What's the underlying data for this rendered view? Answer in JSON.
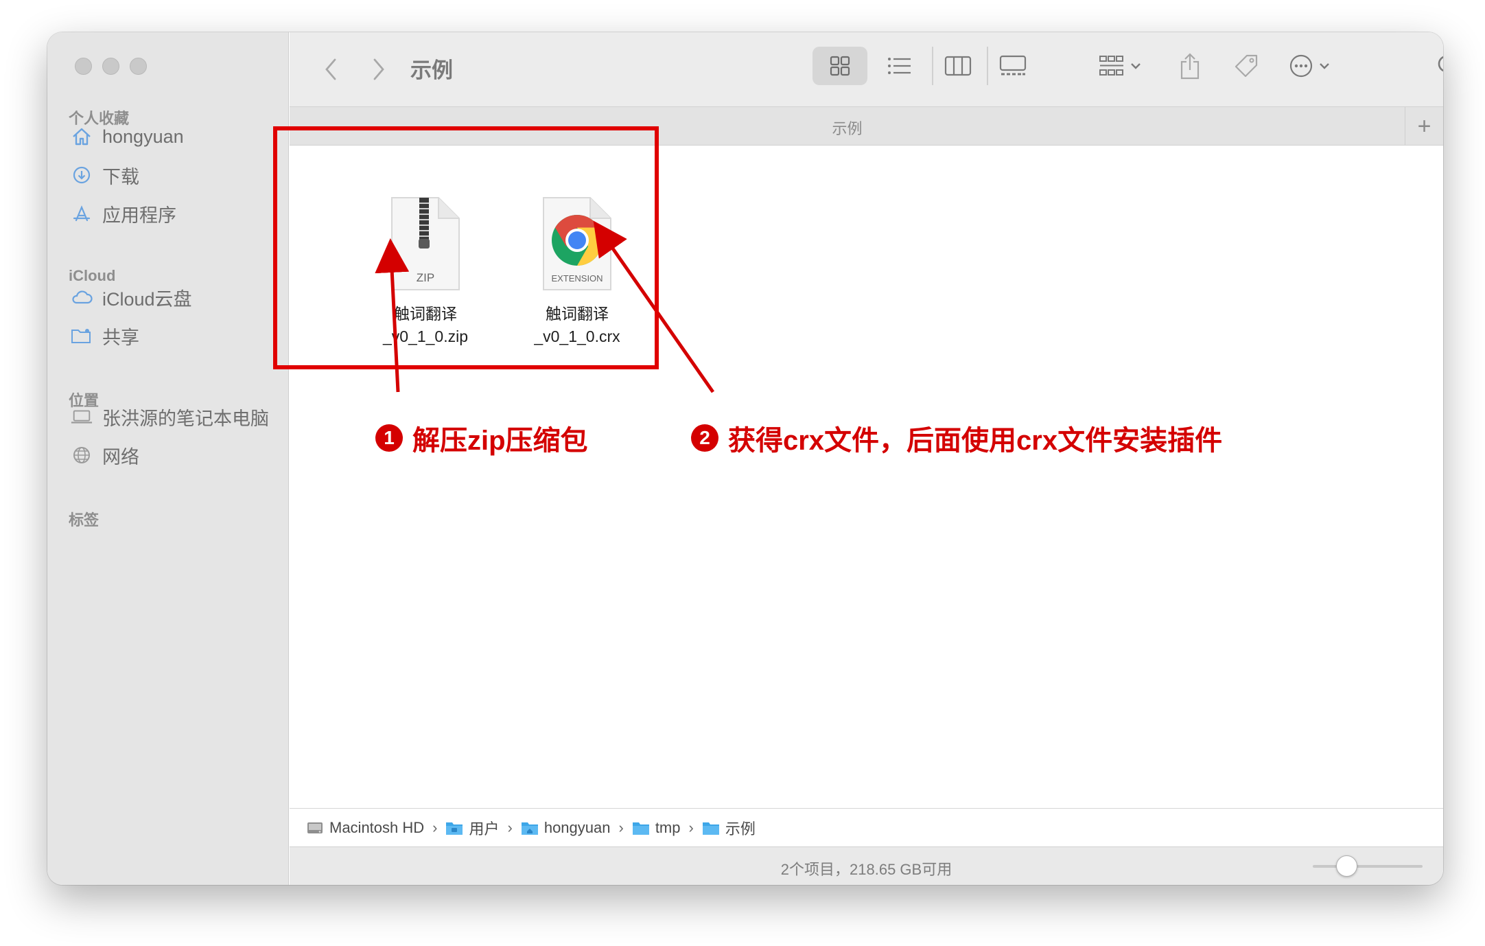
{
  "window": {
    "title": "示例"
  },
  "sidebar": {
    "favorites_header": "个人收藏",
    "favorites": [
      {
        "label": "hongyuan",
        "icon": "house-icon"
      },
      {
        "label": "下载",
        "icon": "download-icon"
      },
      {
        "label": "应用程序",
        "icon": "applications-icon"
      }
    ],
    "icloud_header": "iCloud",
    "icloud": [
      {
        "label": "iCloud云盘",
        "icon": "cloud-icon"
      },
      {
        "label": "共享",
        "icon": "shared-folder-icon"
      }
    ],
    "locations_header": "位置",
    "locations": [
      {
        "label": "张洪源的笔记本电脑",
        "icon": "laptop-icon"
      },
      {
        "label": "网络",
        "icon": "globe-icon"
      }
    ],
    "tags_header": "标签"
  },
  "tabbar": {
    "label": "示例",
    "plus": "+"
  },
  "files": [
    {
      "name_line1": "触词翻译",
      "name_line2": "_v0_1_0.zip",
      "type_label": "ZIP",
      "icon": "zip-archive-icon"
    },
    {
      "name_line1": "触词翻译",
      "name_line2": "_v0_1_0.crx",
      "type_label": "EXTENSION",
      "icon": "chrome-extension-icon"
    }
  ],
  "annotations": [
    {
      "num": "1",
      "text": "解压zip压缩包"
    },
    {
      "num": "2",
      "text": "获得crx文件，后面使用crx文件安装插件"
    }
  ],
  "pathbar": [
    {
      "label": "Macintosh HD",
      "icon": "hard-drive-icon"
    },
    {
      "label": "用户",
      "icon": "folder-icon"
    },
    {
      "label": "hongyuan",
      "icon": "home-folder-icon"
    },
    {
      "label": "tmp",
      "icon": "folder-icon"
    },
    {
      "label": "示例",
      "icon": "folder-icon"
    }
  ],
  "pathbar_separator": "›",
  "status": {
    "text": "2个项目，218.65 GB可用"
  },
  "colors": {
    "annotation_red": "#d40000",
    "folder_blue": "#3da6e8",
    "sidebar_bg": "#e5e5e5"
  }
}
